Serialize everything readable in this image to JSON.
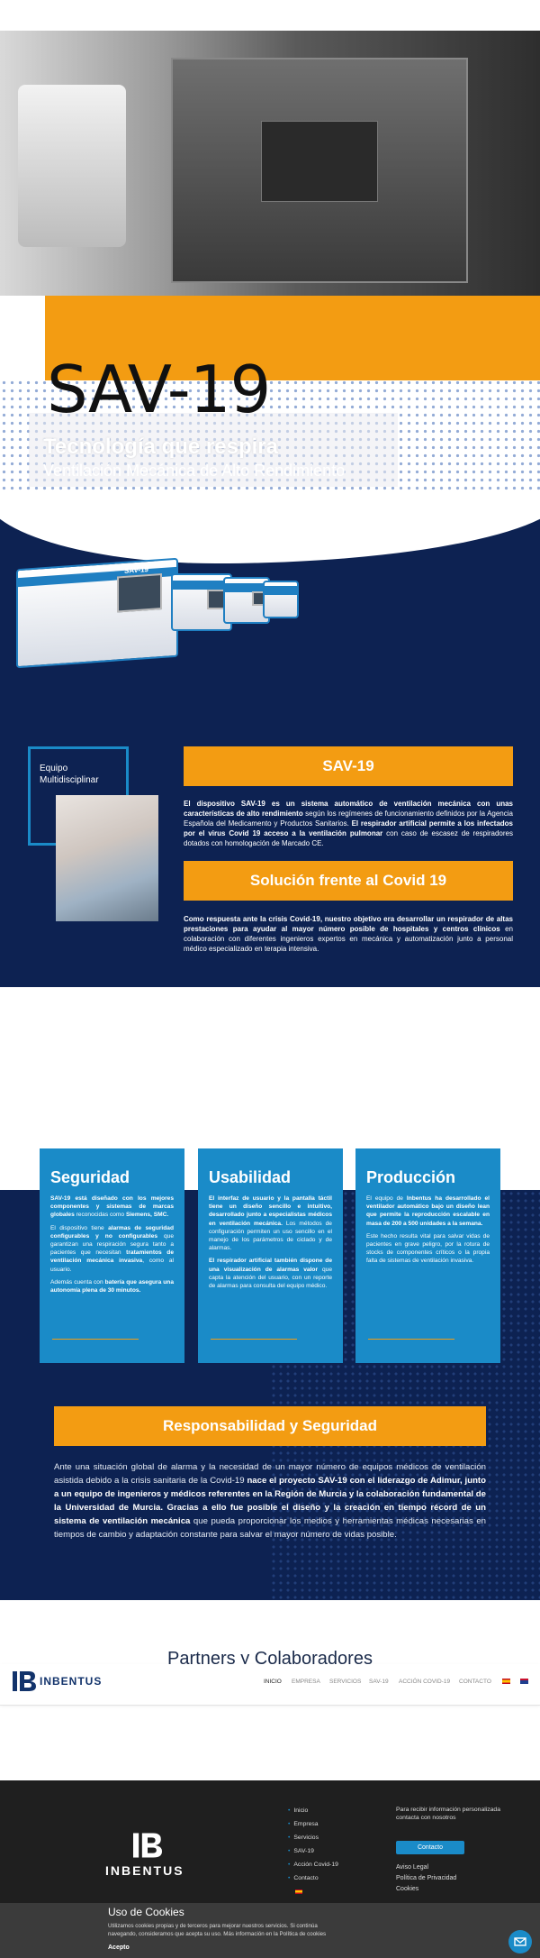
{
  "colors": {
    "navy": "#0d2252",
    "orange": "#f39c12",
    "blue": "#1a8bc8",
    "footer": "#1f1f1f"
  },
  "hero": {
    "title": "SAV-19",
    "subtitle": "Tecnología que respira",
    "tagline": "Ventilación Mecánica de Alto Rendimiento",
    "unit_label": "SAV-19"
  },
  "equipo": {
    "label": "Equipo Multidisciplinar"
  },
  "sav": {
    "button": "SAV-19",
    "text_parts": [
      "El dispositivo SAV-19 es un sistema automático de ventilación mecánica con unas características de alto rendimiento",
      " según los regímenes de funcionamiento definidos por la Agencia Española del Medicamento y Productos Sanitarios. ",
      "El respirador artificial permite a los infectados por el virus Covid 19 acceso a la ventilación pulmonar",
      " con caso de escasez de respiradores dotados con homologación de Marcado CE."
    ]
  },
  "solucion": {
    "button": "Solución frente al Covid 19",
    "text_parts": [
      "Como respuesta ante la crisis Covid-19, nuestro objetivo era desarrollar un respirador de altas prestaciones para ayudar al mayor número posible de hospitales y centros clínicos",
      " en colaboración con diferentes ingenieros expertos en mecánica y automatización junto a personal médico especializado en terapia intensiva."
    ]
  },
  "cards": [
    {
      "title": "Seguridad",
      "paragraphs": [
        [
          "SAV-19 está diseñado con los mejores componentes y sistemas de marcas globales",
          " reconocidas como ",
          "Siemens, SMC.",
          ""
        ],
        [
          "",
          "El dispositivo tiene ",
          "alarmas de seguridad configurables y no configurables",
          " que garantizan una respiración segura tanto a pacientes que necesitan "
        ],
        [
          "tratamientos de ventilación mecánica invasiva",
          ", como al usuario.",
          "",
          ""
        ],
        [
          "",
          "Además cuenta con ",
          "batería que asegura una autonomía plena de 30 minutos.",
          ""
        ]
      ]
    },
    {
      "title": "Usabilidad",
      "paragraphs": [
        [
          "El interfaz de usuario y la pantalla táctil tiene un diseño sencillo e intuitivo, desarrollado junto a especialistas médicos en ventilación mecánica.",
          " Los métodos de configuración permiten un uso sencillo en el manejo de los parámetros de ciclado y de alarmas.",
          "",
          ""
        ],
        [
          "El respirador artificial también dispone de una visualización de alarmas valor",
          " que capta la atención del usuario, con un reporte de alarmas para consulta del equipo médico.",
          "",
          ""
        ]
      ]
    },
    {
      "title": "Producción",
      "paragraphs": [
        [
          "",
          "El equipo de ",
          "Inbentus ha desarrollado el ventilador automático bajo un diseño lean que permite la reproducción escalable en masa de 200 a 500 unidades a la semana.",
          ""
        ],
        [
          "",
          "Este hecho resulta vital para salvar vidas de pacientes en grave peligro, por la rotura de stocks de componentes críticos o la propia falta de sistemas de ventilación invasiva.",
          "",
          ""
        ]
      ]
    }
  ],
  "responsabilidad": {
    "button": "Responsabilidad y Seguridad",
    "text_parts": [
      "Ante una situación global de alarma y la necesidad de un mayor número de equipos médicos de ventilación asistida debido a la crisis sanitaria de la Covid-19 ",
      "nace el proyecto SAV-19 con el liderazgo de Adimur, junto a un equipo de ingenieros y médicos referentes en la Región de Murcia y la colaboración fundamental de la Universidad de Murcia. Gracias a ello fue posible el diseño y la creación en tiempo récord de un sistema de ventilación mecánica",
      " que pueda proporcionar los medios y herramientas médicas necesarias en tiempos de cambio y adaptación constante para salvar el mayor número de vidas posible."
    ]
  },
  "partners": {
    "title": "Partners y Colaboradores"
  },
  "nav": {
    "logo": "INBENTUS",
    "items": [
      "INICIO",
      "EMPRESA",
      "SERVICIOS",
      "SAV-19",
      "ACCIÓN COVID-19",
      "CONTACTO"
    ]
  },
  "footer": {
    "logo": "INBENTUS",
    "links": [
      "Inicio",
      "Empresa",
      "Servicios",
      "SAV-19",
      "Acción Covid-19",
      "Contacto"
    ],
    "note": "Para recibir información personalizada contacta con nosotros",
    "contact_button": "Contacto",
    "legal": [
      "Aviso Legal",
      "Política de Privacidad",
      "Cookies"
    ]
  },
  "cookies": {
    "title": "Uso de Cookies",
    "text": "Utilizamos cookies propias y de terceros para mejorar nuestros servicios. Si continúa navegando, consideramos que acepta su uso. Más información en la Política de cookies",
    "accept": "Acepto"
  }
}
